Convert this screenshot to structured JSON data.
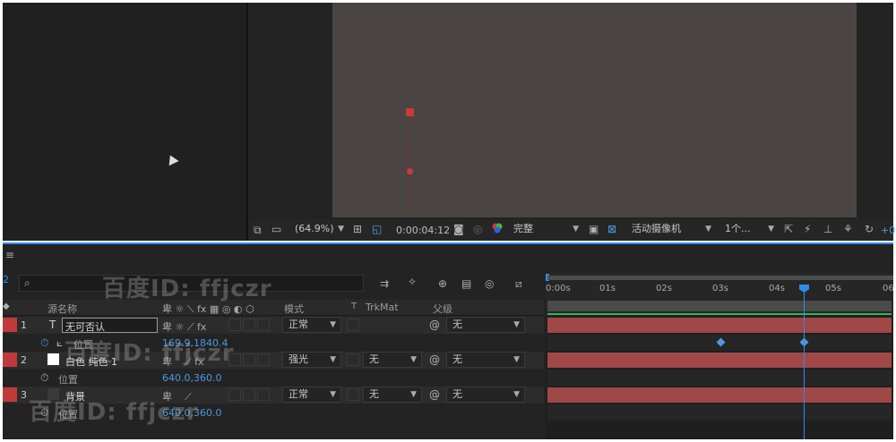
{
  "viewer": {
    "zoom": "(64.9%)",
    "timecode": "0:00:04:12",
    "resolution": "完整",
    "camera": "活动摄像机",
    "views": "1个...",
    "plus": "+0"
  },
  "timeline": {
    "panel_menu": "≡",
    "search_placeholder": "",
    "header": {
      "col_source": "源名称",
      "col_mode": "模式",
      "col_t": "T",
      "col_trkmat": "TrkMat",
      "col_parent": "父级"
    },
    "ruler": [
      "0:00s",
      "01s",
      "02s",
      "03s",
      "04s",
      "05s",
      "06"
    ],
    "layers": [
      {
        "num": "1",
        "name": "无可否认",
        "mode": "正常",
        "trkmat": "",
        "parent": "无",
        "prop_label": "位置",
        "prop_value": "169.9,1840.4"
      },
      {
        "num": "2",
        "name": "白色 纯色 1",
        "mode": "强光",
        "trkmat": "无",
        "parent": "无",
        "prop_label": "位置",
        "prop_value": "640.0,360.0"
      },
      {
        "num": "3",
        "name": "背景",
        "mode": "正常",
        "trkmat": "无",
        "parent": "无",
        "prop_label": "位置",
        "prop_value": "640.0,360.0"
      }
    ],
    "side_num": "2"
  },
  "watermarks": [
    "百度ID: ffjczr",
    "百度ID: ffjczr",
    "百度ID: ffjczr"
  ],
  "colors": {
    "label_red": "#c13a3a",
    "bar_red": "#a04747",
    "accent_blue": "#2d8cf0",
    "work_green": "#35b54a"
  },
  "icons": [
    "camera-icon",
    "color-channels-icon",
    "grid-icon",
    "region-icon",
    "mask-icon",
    "stopwatch-icon",
    "graph-icon",
    "pickwhip-icon",
    "comp-flowchart-icon",
    "draft-3d-icon",
    "shy-icon",
    "frame-blend-icon",
    "motion-blur-icon",
    "graph-editor-icon"
  ]
}
